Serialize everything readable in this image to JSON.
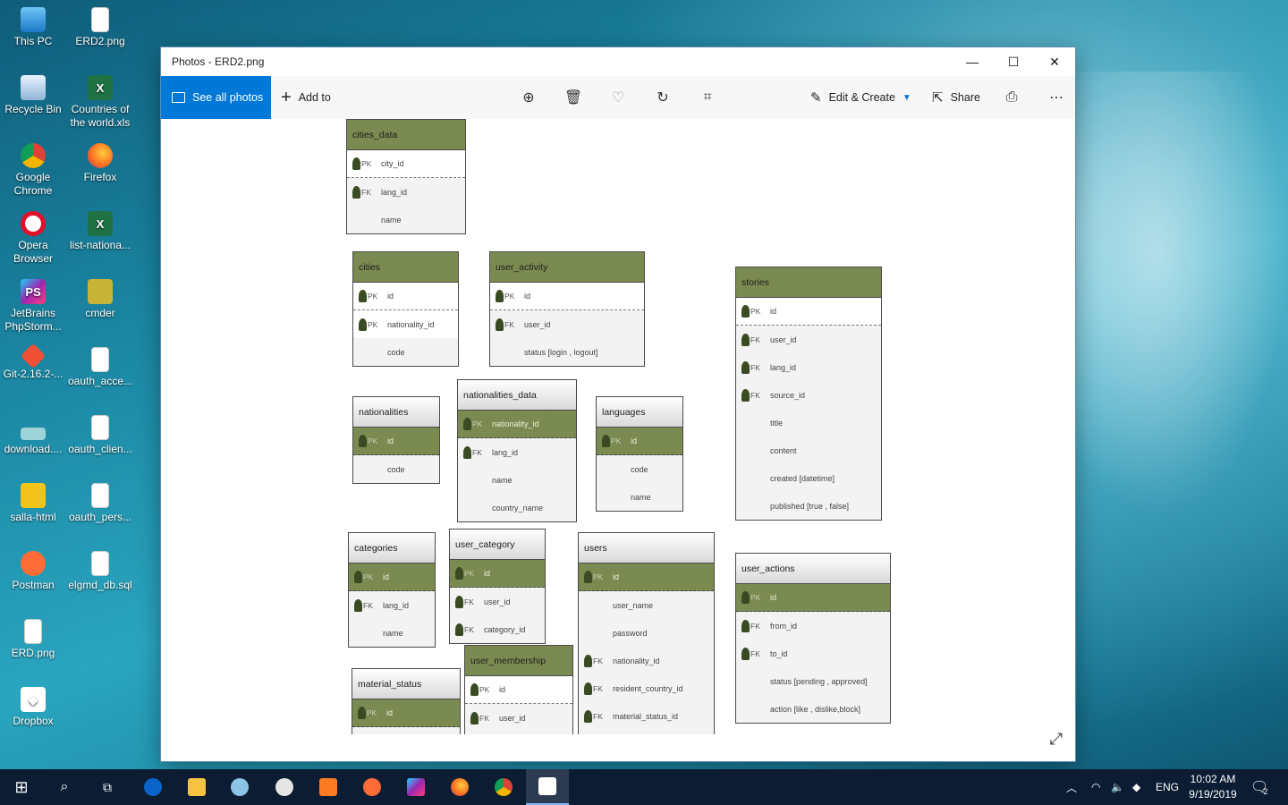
{
  "desktop": {
    "icons": [
      {
        "label": "This PC",
        "glyph": "pc-icon"
      },
      {
        "label": "ERD2.png",
        "glyph": "image-file-icon"
      },
      {
        "label": "Recycle Bin",
        "glyph": "recycle-bin-icon"
      },
      {
        "label": "Countries of the world.xls",
        "glyph": "excel-file-icon"
      },
      {
        "label": "Google Chrome",
        "glyph": "chrome-icon"
      },
      {
        "label": "Firefox",
        "glyph": "firefox-icon"
      },
      {
        "label": "Opera Browser",
        "glyph": "opera-icon"
      },
      {
        "label": "list-nationa...",
        "glyph": "excel-file-icon"
      },
      {
        "label": "JetBrains PhpStorm...",
        "glyph": "phpstorm-icon"
      },
      {
        "label": "cmder",
        "glyph": "cmder-icon"
      },
      {
        "label": "Git-2.16.2-...",
        "glyph": "git-icon"
      },
      {
        "label": "oauth_acce...",
        "glyph": "file-icon"
      },
      {
        "label": "download....",
        "glyph": "image-file-icon"
      },
      {
        "label": "oauth_clien...",
        "glyph": "file-icon"
      },
      {
        "label": "salla-html",
        "glyph": "folder-icon"
      },
      {
        "label": "oauth_pers...",
        "glyph": "file-icon"
      },
      {
        "label": "Postman",
        "glyph": "postman-icon"
      },
      {
        "label": "elgmd_db.sql",
        "glyph": "file-icon"
      },
      {
        "label": "ERD.png",
        "glyph": "image-file-icon"
      },
      {
        "label": "Dropbox",
        "glyph": "dropbox-icon"
      }
    ]
  },
  "window": {
    "title": "Photos - ERD2.png",
    "toolbar": {
      "see_all": "See all photos",
      "add_to": "Add to",
      "edit_create": "Edit & Create",
      "share": "Share"
    }
  },
  "erd": {
    "tables": [
      {
        "name": "cities_data",
        "rows": [
          [
            "PK",
            "city_id"
          ],
          [
            "FK",
            "lang_id"
          ],
          [
            "",
            "name"
          ]
        ]
      },
      {
        "name": "cities",
        "rows": [
          [
            "PK",
            "id"
          ],
          [
            "PK",
            "nationality_id"
          ],
          [
            "",
            "code"
          ]
        ]
      },
      {
        "name": "user_activity",
        "rows": [
          [
            "PK",
            "id"
          ],
          [
            "FK",
            "user_id"
          ],
          [
            "",
            "status [login , logout]"
          ]
        ]
      },
      {
        "name": "stories",
        "rows": [
          [
            "PK",
            "id"
          ],
          [
            "FK",
            "user_id"
          ],
          [
            "FK",
            "lang_id"
          ],
          [
            "FK",
            "source_id"
          ],
          [
            "",
            "title"
          ],
          [
            "",
            "content"
          ],
          [
            "",
            "created [datetime]"
          ],
          [
            "",
            "published [true , false]"
          ]
        ]
      },
      {
        "name": "nationalities",
        "rows": [
          [
            "PK",
            "id"
          ],
          [
            "",
            "code"
          ]
        ]
      },
      {
        "name": "nationalities_data",
        "rows": [
          [
            "PK",
            "nationality_id"
          ],
          [
            "FK",
            "lang_id"
          ],
          [
            "",
            "name"
          ],
          [
            "",
            "country_name"
          ]
        ]
      },
      {
        "name": "languages",
        "rows": [
          [
            "PK",
            "id"
          ],
          [
            "",
            "code"
          ],
          [
            "",
            "name"
          ]
        ]
      },
      {
        "name": "categories",
        "rows": [
          [
            "PK",
            "id"
          ],
          [
            "FK",
            "lang_id"
          ],
          [
            "",
            "name"
          ]
        ]
      },
      {
        "name": "user_category",
        "rows": [
          [
            "PK",
            "id"
          ],
          [
            "FK",
            "user_id"
          ],
          [
            "FK",
            "category_id"
          ]
        ]
      },
      {
        "name": "users",
        "rows": [
          [
            "PK",
            "id"
          ],
          [
            "",
            "user_name"
          ],
          [
            "",
            "password"
          ],
          [
            "FK",
            "nationality_id"
          ],
          [
            "FK",
            "resident_country_id"
          ],
          [
            "FK",
            "material_status_id"
          ]
        ]
      },
      {
        "name": "user_actions",
        "rows": [
          [
            "PK",
            "id"
          ],
          [
            "FK",
            "from_id"
          ],
          [
            "FK",
            "to_id"
          ],
          [
            "",
            "status [pending , approved]"
          ],
          [
            "",
            "action [like , dislike,block]"
          ]
        ]
      },
      {
        "name": "material_status",
        "rows": [
          [
            "PK",
            "id"
          ]
        ]
      },
      {
        "name": "user_membership",
        "rows": [
          [
            "PK",
            "id"
          ],
          [
            "FK",
            "user_id"
          ]
        ]
      }
    ]
  },
  "taskbar": {
    "lang": "ENG",
    "time": "10:02 AM",
    "date": "9/19/2019",
    "notifications": "2"
  }
}
